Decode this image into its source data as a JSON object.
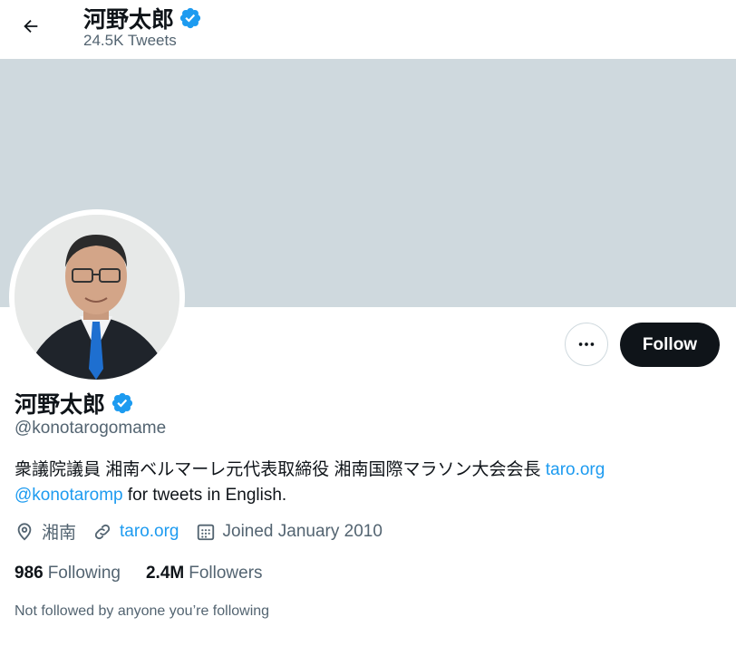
{
  "header": {
    "title": "河野太郎",
    "subtitle": "24.5K Tweets"
  },
  "profile": {
    "name": "河野太郎",
    "handle": "@konotarogomame",
    "bio_text": "衆議院議員 湘南ベルマーレ元代表取締役 湘南国際マラソン大会会長 ",
    "bio_link": "taro.org",
    "bio_mention": "@konotaromp",
    "bio_tail": " for tweets in English.",
    "location": "湘南",
    "website": "taro.org",
    "joined": "Joined January 2010",
    "following_count": "986",
    "following_label": "Following",
    "followers_count": "2.4M",
    "followers_label": "Followers",
    "not_followed_text": "Not followed by anyone you’re following"
  },
  "actions": {
    "follow_label": "Follow"
  },
  "icons": {
    "back": "arrow-left-icon",
    "verified": "verified-badge-icon",
    "more": "more-dots-icon",
    "location": "location-pin-icon",
    "link": "link-icon",
    "calendar": "calendar-icon"
  },
  "colors": {
    "banner": "#cfd9de",
    "accent": "#1d9bf0",
    "button_dark": "#0f1419",
    "secondary_text": "#536471"
  }
}
